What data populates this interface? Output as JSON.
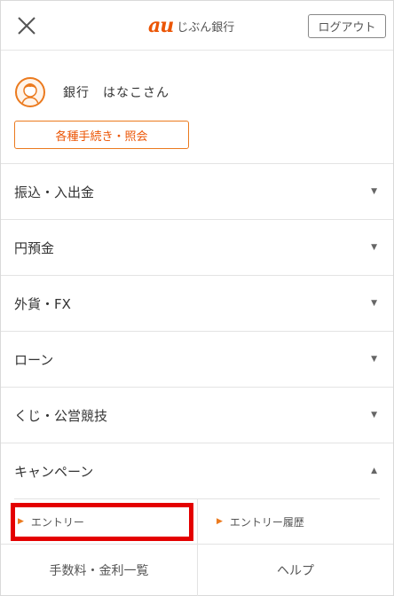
{
  "header": {
    "brand_mark": "au",
    "brand_name": "じぶん銀行",
    "logout_label": "ログアウト"
  },
  "user": {
    "name": "銀行　はなこさん"
  },
  "procedures_button": "各種手続き・照会",
  "menu": {
    "items": [
      {
        "label": "振込・入出金",
        "state": "collapsed",
        "caret": "▼"
      },
      {
        "label": "円預金",
        "state": "collapsed",
        "caret": "▼"
      },
      {
        "label": "外貨・FX",
        "state": "collapsed",
        "caret": "▼"
      },
      {
        "label": "ローン",
        "state": "collapsed",
        "caret": "▼"
      },
      {
        "label": "くじ・公営競技",
        "state": "collapsed",
        "caret": "▼"
      },
      {
        "label": "キャンペーン",
        "state": "expanded",
        "caret": "▲"
      }
    ],
    "campaign_sub": [
      {
        "label": "エントリー",
        "bullet": "▶"
      },
      {
        "label": "エントリー履歴",
        "bullet": "▶"
      }
    ]
  },
  "footer": {
    "fees_label": "手数料・金利一覧",
    "help_label": "ヘルプ"
  },
  "colors": {
    "brand": "#eb5505",
    "accent": "#eb7a1e",
    "highlight": "#e40000"
  }
}
